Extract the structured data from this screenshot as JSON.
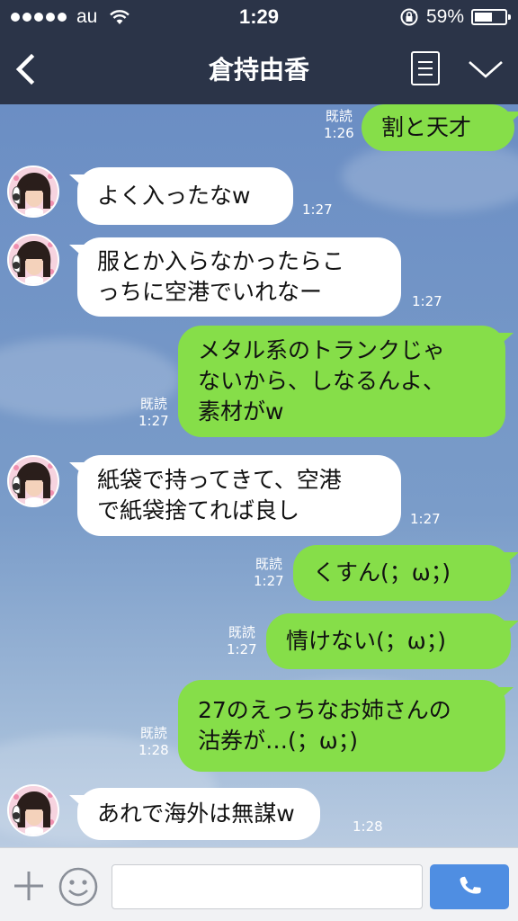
{
  "status_bar": {
    "carrier": "au",
    "time": "1:29",
    "battery_percent": "59%",
    "battery_level": 0.59,
    "signal_dots": 5
  },
  "nav": {
    "title": "倉持由香",
    "back_icon": "chevron-left-icon",
    "list_icon": "list-icon",
    "menu_icon": "chevron-down-icon"
  },
  "chat": {
    "messages": [
      {
        "side": "out",
        "lines": [
          "割と天才"
        ],
        "read": "既読",
        "time": "1:26"
      },
      {
        "side": "in",
        "lines": [
          "よく入ったなw"
        ],
        "time": "1:27"
      },
      {
        "side": "in",
        "lines": [
          "服とか入らなかったらこ",
          "っちに空港でいれなー"
        ],
        "time": "1:27"
      },
      {
        "side": "out",
        "lines": [
          "メタル系のトランクじゃ",
          "ないから、しなるんよ、",
          "素材がw"
        ],
        "read": "既読",
        "time": "1:27"
      },
      {
        "side": "in",
        "lines": [
          "紙袋で持ってきて、空港",
          "で紙袋捨てれば良し"
        ],
        "time": "1:27"
      },
      {
        "side": "out",
        "lines": [
          "くすん(；ω；)"
        ],
        "read": "既読",
        "time": "1:27"
      },
      {
        "side": "out",
        "lines": [
          "情けない(；ω；)"
        ],
        "read": "既読",
        "time": "1:27"
      },
      {
        "side": "out",
        "lines": [
          "27のえっちなお姉さんの",
          "沽券が…(；ω；)"
        ],
        "read": "既読",
        "time": "1:28"
      },
      {
        "side": "in",
        "lines": [
          "あれで海外は無謀w"
        ],
        "time": "1:28"
      }
    ]
  },
  "input": {
    "plus_icon": "plus-icon",
    "emoji_icon": "emoji-icon",
    "call_icon": "phone-icon",
    "text_value": ""
  },
  "colors": {
    "header_bg": "#2b3448",
    "outgoing_bubble": "#86de49",
    "incoming_bubble": "#ffffff",
    "call_button": "#4f8ee2"
  }
}
